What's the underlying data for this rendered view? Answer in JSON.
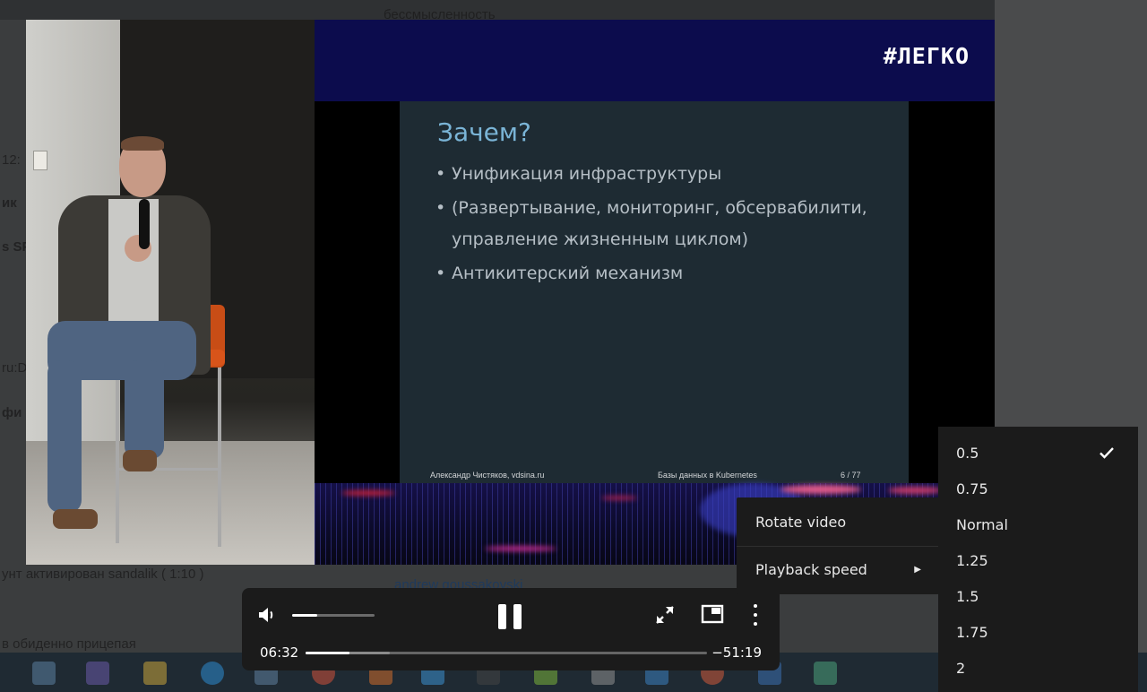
{
  "background": {
    "texts": [
      "бессмысленность",
      "12:",
      "ик",
      "s SPI",
      "ru:D",
      "фи",
      "унт активирован sandalik ( 1:10 )",
      "andrew goussakovski",
      "в обиденно прицепая"
    ]
  },
  "video": {
    "slide": {
      "hashtag": "#ЛЕГКО",
      "title": "Зачем?",
      "bullets": [
        "Унификация инфраструктуры",
        "(Развертывание, мониторинг, обсервабилити, управление жизненным циклом)",
        "Антикитерский механизм"
      ],
      "footer": {
        "author": "Александр Чистяков, vdsina.ru",
        "talk": "Базы данных в Kubernetes",
        "page": "6 / 77"
      }
    }
  },
  "controls": {
    "current_time": "06:32",
    "remaining_time": "−51:19",
    "progress_fraction": 0.109,
    "buffered_fraction": 0.21,
    "volume_fraction": 0.3,
    "icons": [
      "volume-icon",
      "pause-icon",
      "fullscreen-icon",
      "picture-in-picture-icon",
      "more-vertical-icon"
    ]
  },
  "context_menu": {
    "items": [
      {
        "label": "Rotate video"
      },
      {
        "label": "Playback speed",
        "has_submenu": true
      }
    ]
  },
  "speed_menu": {
    "options": [
      "0.5",
      "0.75",
      "Normal",
      "1.25",
      "1.5",
      "1.75",
      "2"
    ],
    "selected": "0.5"
  }
}
